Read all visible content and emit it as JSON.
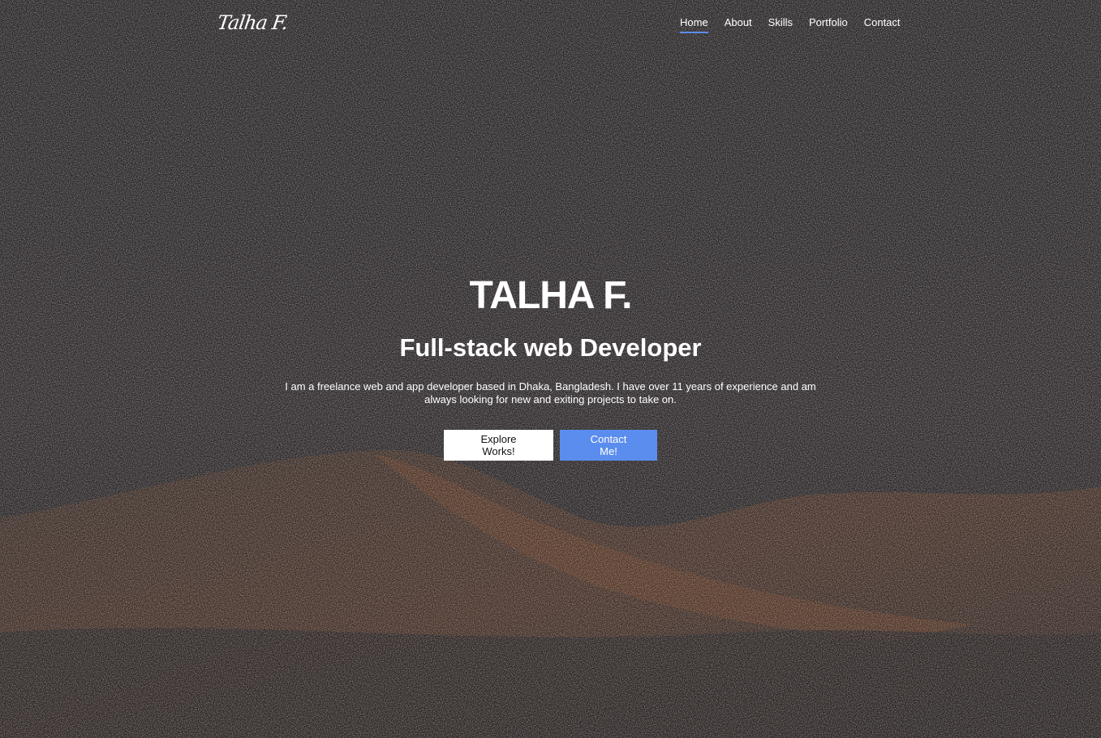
{
  "brand": {
    "logo": "Talha F."
  },
  "nav": {
    "items": [
      {
        "label": "Home",
        "active": true
      },
      {
        "label": "About",
        "active": false
      },
      {
        "label": "Skills",
        "active": false
      },
      {
        "label": "Portfolio",
        "active": false
      },
      {
        "label": "Contact",
        "active": false
      }
    ]
  },
  "hero": {
    "name": "TALHA F.",
    "role": "Full-stack web Developer",
    "description": "I am a freelance web and app developer based in Dhaka, Bangladesh. I have over 11 years of experience and am always looking for new and exiting projects to take on.",
    "primary_button": "Explore Works!",
    "secondary_button": "Contact Me!"
  },
  "colors": {
    "accent": "#5b8def",
    "background": "#252223",
    "text": "#ffffff"
  }
}
